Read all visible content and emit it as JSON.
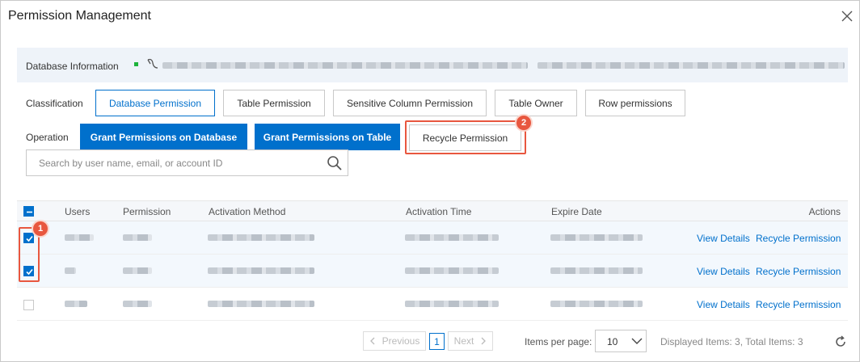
{
  "dialog": {
    "title": "Permission Management"
  },
  "db_info": {
    "label": "Database Information"
  },
  "classification": {
    "label": "Classification",
    "tabs": [
      {
        "label": "Database Permission",
        "active": true
      },
      {
        "label": "Table Permission",
        "active": false
      },
      {
        "label": "Sensitive Column Permission",
        "active": false
      },
      {
        "label": "Table Owner",
        "active": false
      },
      {
        "label": "Row permissions",
        "active": false
      }
    ]
  },
  "operation": {
    "label": "Operation",
    "grant_db_label": "Grant Permissions on Database",
    "grant_table_label": "Grant Permissions on Table",
    "recycle_label": "Recycle Permission"
  },
  "search": {
    "placeholder": "Search by user name, email, or account ID"
  },
  "table": {
    "columns": [
      "Users",
      "Permission",
      "Activation Method",
      "Activation Time",
      "Expire Date",
      "Actions"
    ],
    "rows": [
      {
        "checked": true,
        "view_label": "View Details",
        "recycle_label": "Recycle Permission"
      },
      {
        "checked": true,
        "view_label": "View Details",
        "recycle_label": "Recycle Permission"
      },
      {
        "checked": false,
        "view_label": "View Details",
        "recycle_label": "Recycle Permission"
      }
    ]
  },
  "annotations": {
    "step1": "1",
    "step2": "2",
    "color": "#e8573f"
  },
  "pagination": {
    "previous_label": "Previous",
    "current_page": "1",
    "next_label": "Next",
    "items_per_page_label": "Items per page:",
    "items_per_page_value": "10",
    "summary": "Displayed Items: 3, Total Items: 3"
  },
  "colors": {
    "primary": "#0070cc",
    "header_bg": "#eef3f9",
    "status_green": "#1db33b"
  },
  "icons": [
    "close-icon",
    "search-icon",
    "chevron-down-icon",
    "chevron-left-icon",
    "chevron-right-icon",
    "refresh-icon",
    "checkmark-icon"
  ]
}
